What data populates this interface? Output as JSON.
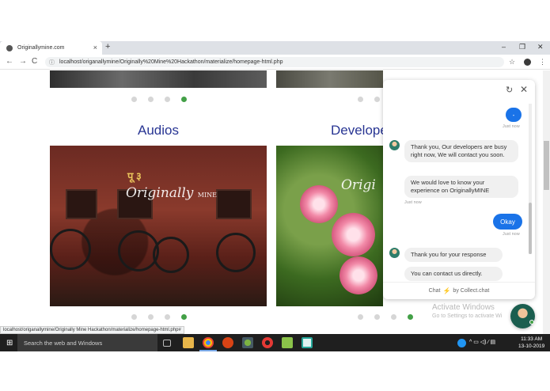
{
  "browser": {
    "tab_title": "Originallymine.com",
    "tab_close": "×",
    "new_tab": "+",
    "minimize": "–",
    "restore": "❐",
    "close": "✕",
    "back": "←",
    "forward": "→",
    "reload": "C",
    "url": "localhost/origanallymine/Originally%20Mine%20Hackathon/materialize/homepage-html.php",
    "bookmark_star": "☆",
    "menu": "⋮"
  },
  "page": {
    "audios_title": "Audios",
    "developers_title": "Develope",
    "watermark_main": "Originally",
    "watermark_sub": "MINE",
    "watermark_right": "Origi",
    "hindi_text": "पू ३",
    "top_dots_left_active": 4,
    "bottom_dots_left_active": 4,
    "bottom_dots_right_active": 4,
    "activate_title": "Activate Windows",
    "activate_sub": "Go to Settings to activate Wi",
    "status_url": "localhost/origanallymine/Originally Mine Hackathon/materialize/homepage-html.php#"
  },
  "chat": {
    "reload_icon": "↻",
    "close_icon": "✕",
    "first_user_bubble": "-",
    "ts_just_now": "Just now",
    "msg1": "Thank you, Our developers are busy right now, We will contact you soon.",
    "msg2": "We would love to know your experience on OriginallyMINE",
    "user_reply": "Okay",
    "msg3": "Thank you for your response",
    "msg4": "You can contact us directly.",
    "footer_pre": "Chat",
    "footer_post": "by Collect.chat"
  },
  "taskbar": {
    "start": "⊞",
    "search_placeholder": "Search the web and Windows",
    "time": "11:33 AM",
    "date": "13-10-2019",
    "tray": "^ ▭ ◁) ∕ ▤"
  }
}
